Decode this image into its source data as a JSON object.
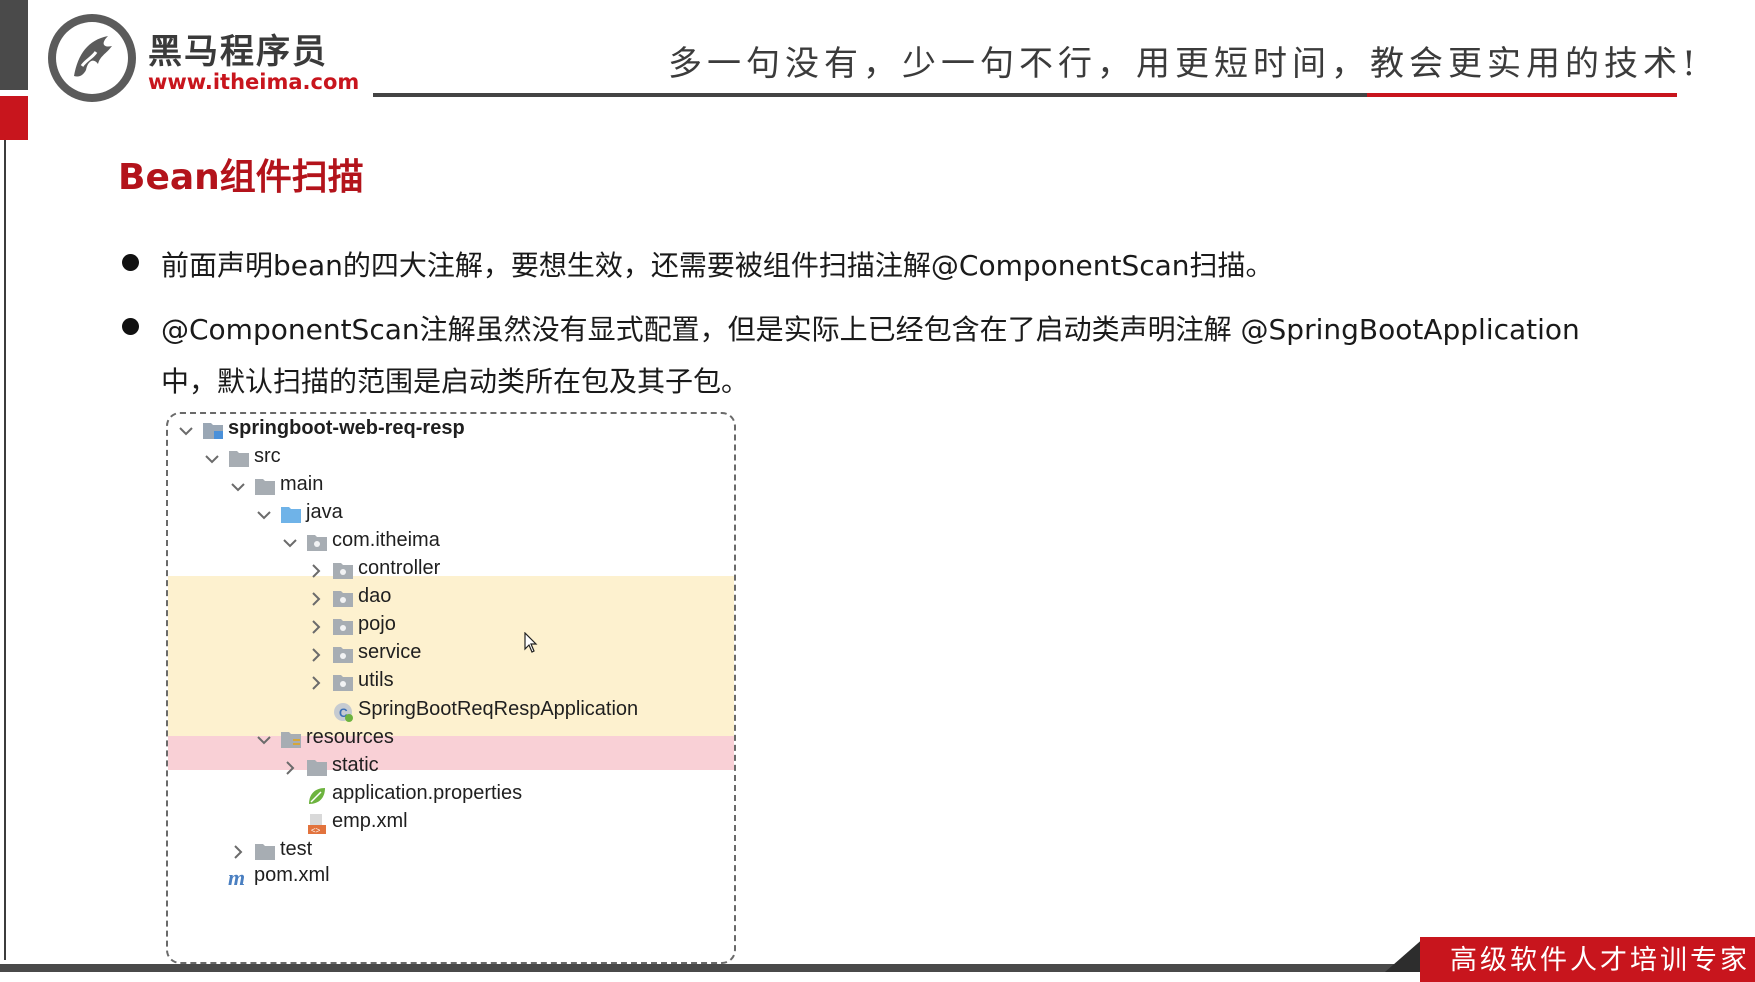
{
  "header": {
    "logo_cn": "黑马程序员",
    "logo_url": "www.itheima.com",
    "slogan": "多一句没有，少一句不行，用更短时间，教会更实用的技术!"
  },
  "slide": {
    "title": "Bean组件扫描",
    "bullets": [
      "前面声明bean的四大注解，要想生效，还需要被组件扫描注解@ComponentScan扫描。",
      "@ComponentScan注解虽然没有显式配置，但是实际上已经包含在了启动类声明注解 @SpringBootApplication",
      "中，默认扫描的范围是启动类所在包及其子包。"
    ]
  },
  "tree": {
    "items": [
      {
        "label": "springboot-web-req-resp",
        "icon": "module-folder-icon",
        "chevron": "expanded"
      },
      {
        "label": "src",
        "icon": "folder-icon",
        "chevron": "expanded"
      },
      {
        "label": "main",
        "icon": "folder-icon",
        "chevron": "expanded"
      },
      {
        "label": "java",
        "icon": "source-root-folder-icon",
        "chevron": "expanded"
      },
      {
        "label": "com.itheima",
        "icon": "package-icon",
        "chevron": "expanded"
      },
      {
        "label": "controller",
        "icon": "package-icon",
        "chevron": "collapsed",
        "highlight": "yellow"
      },
      {
        "label": "dao",
        "icon": "package-icon",
        "chevron": "collapsed",
        "highlight": "yellow"
      },
      {
        "label": "pojo",
        "icon": "package-icon",
        "chevron": "collapsed",
        "highlight": "yellow"
      },
      {
        "label": "service",
        "icon": "package-icon",
        "chevron": "collapsed",
        "highlight": "yellow"
      },
      {
        "label": "utils",
        "icon": "package-icon",
        "chevron": "collapsed",
        "highlight": "yellow"
      },
      {
        "label": "SpringBootReqRespApplication",
        "icon": "spring-class-icon",
        "chevron": "none",
        "highlight": "pink"
      },
      {
        "label": "resources",
        "icon": "resources-folder-icon",
        "chevron": "expanded"
      },
      {
        "label": "static",
        "icon": "folder-icon",
        "chevron": "collapsed"
      },
      {
        "label": "application.properties",
        "icon": "spring-properties-icon",
        "chevron": "none"
      },
      {
        "label": "emp.xml",
        "icon": "xml-file-icon",
        "chevron": "none"
      },
      {
        "label": "test",
        "icon": "folder-icon",
        "chevron": "collapsed"
      },
      {
        "label": "pom.xml",
        "icon": "maven-icon",
        "chevron": "none"
      }
    ]
  },
  "footer": {
    "tagline": "高级软件人才培训专家"
  },
  "colors": {
    "brand_red": "#c8151d",
    "highlight_yellow": "#fdf1cf",
    "highlight_pink": "#f9d0d6"
  }
}
